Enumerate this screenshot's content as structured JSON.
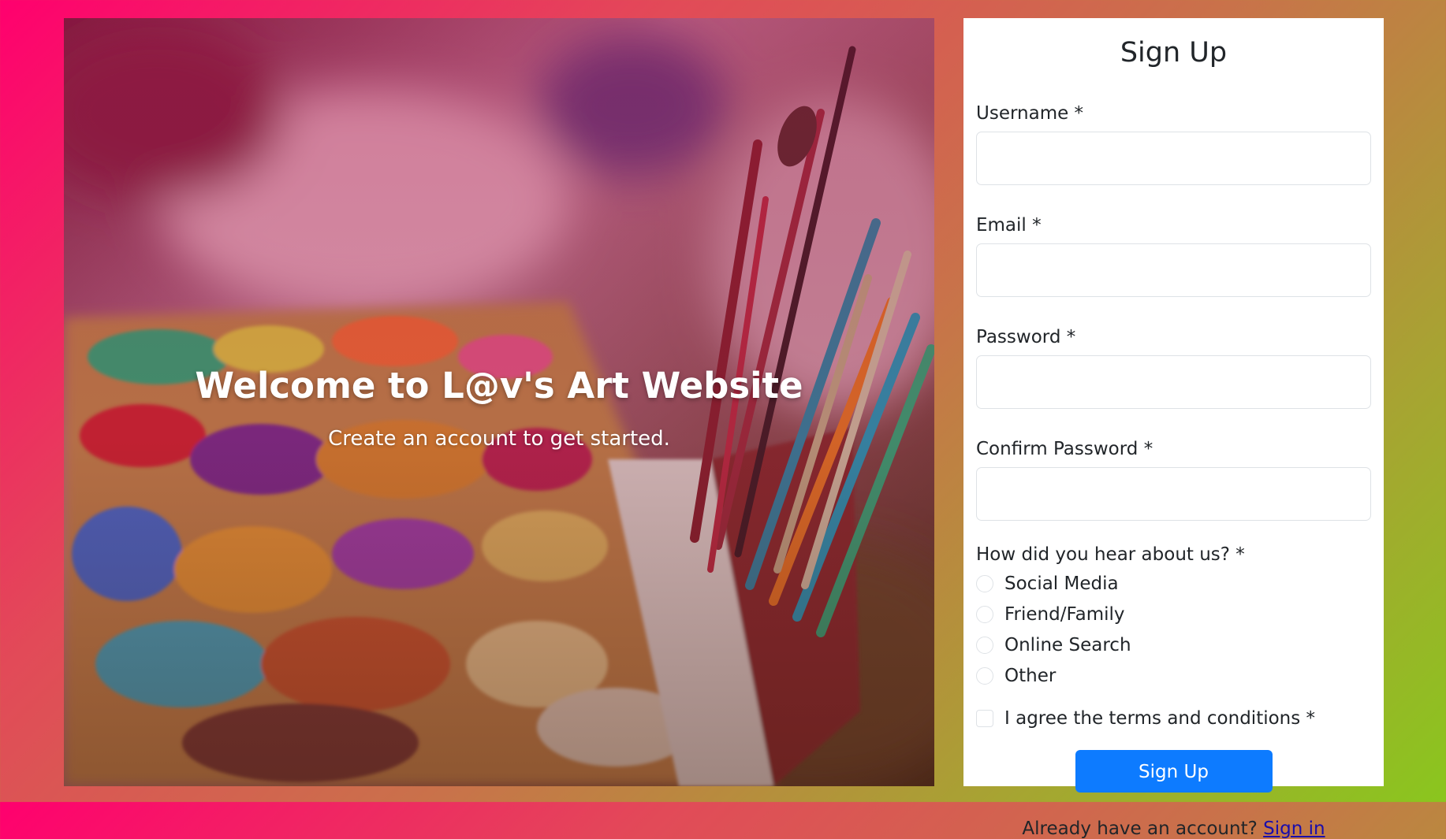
{
  "hero": {
    "title": "Welcome to L@v's Art Website",
    "subtitle": "Create an account to get started."
  },
  "form": {
    "title": "Sign Up",
    "fields": [
      {
        "label": "Username *",
        "value": "",
        "placeholder": ""
      },
      {
        "label": "Email *",
        "value": "",
        "placeholder": ""
      },
      {
        "label": "Password *",
        "value": "",
        "placeholder": ""
      },
      {
        "label": "Confirm Password *",
        "value": "",
        "placeholder": ""
      }
    ],
    "referral": {
      "label": "How did you hear about us? *",
      "options": [
        "Social Media",
        "Friend/Family",
        "Online Search",
        "Other"
      ]
    },
    "terms_label": "I agree the terms and conditions *",
    "submit_label": "Sign Up",
    "footer_text": "Already have an account?",
    "signin_label": "Sign in"
  },
  "colors": {
    "accent": "#0d7bff",
    "link": "#1a0dab",
    "gradient_start": "#ff006e",
    "gradient_end": "#8ac61e"
  },
  "icons": {
    "hero_image": "paint-palette-and-brushes-image"
  }
}
